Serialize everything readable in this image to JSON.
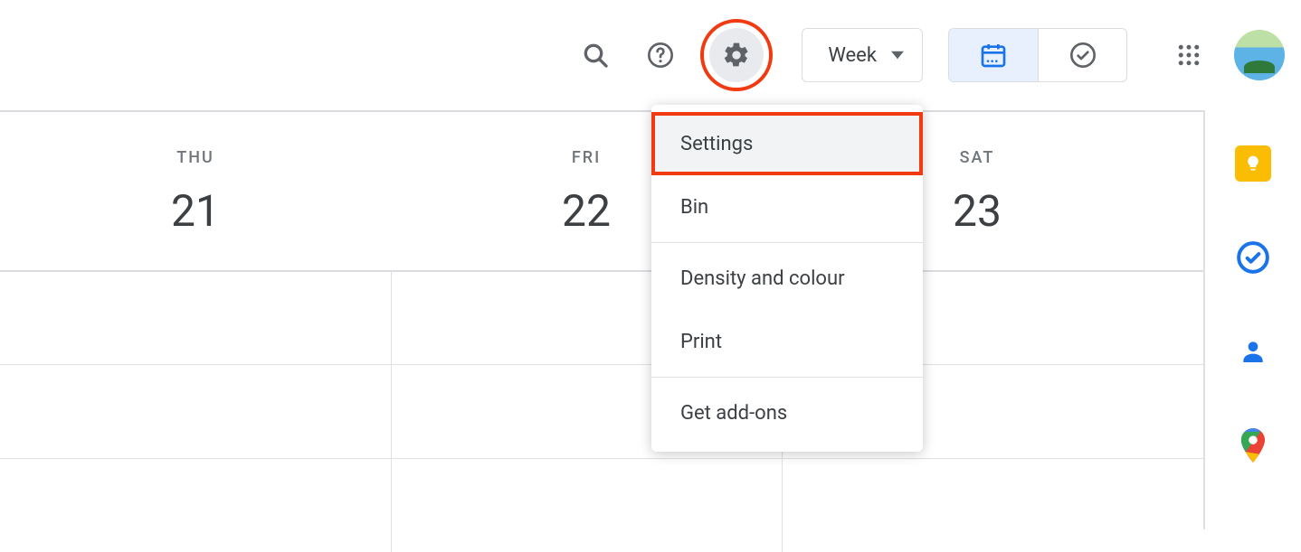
{
  "toolbar": {
    "view_selector": "Week"
  },
  "settings_menu": {
    "items": [
      {
        "label": "Settings",
        "highlighted": true
      },
      {
        "label": "Bin"
      },
      {
        "separator": true
      },
      {
        "label": "Density and colour"
      },
      {
        "label": "Print"
      },
      {
        "separator": true
      },
      {
        "label": "Get add-ons"
      }
    ]
  },
  "calendar": {
    "days": [
      {
        "name": "THU",
        "num": "21"
      },
      {
        "name": "FRI",
        "num": "22"
      },
      {
        "name": "SAT",
        "num": "23"
      }
    ]
  }
}
